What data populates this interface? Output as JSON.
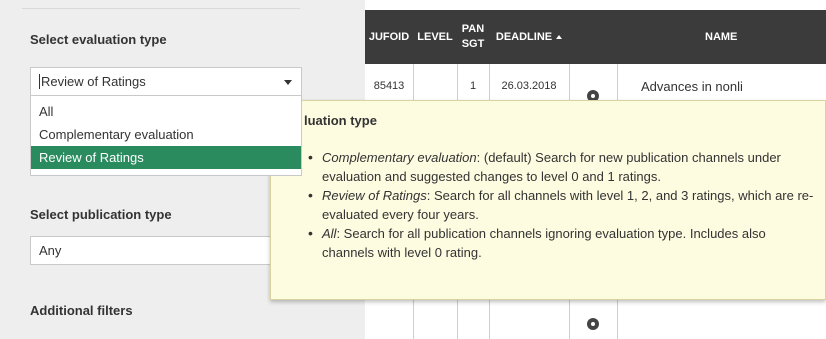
{
  "filters": {
    "evaluation_type": {
      "label": "Select evaluation type",
      "value": "Review of Ratings",
      "options": [
        "All",
        "Complementary evaluation",
        "Review of Ratings"
      ],
      "selected_index": 2
    },
    "publication_type": {
      "label": "Select publication type",
      "value": "Any"
    },
    "additional_filters_label": "Additional filters"
  },
  "table": {
    "columns": [
      {
        "key": "jufoid",
        "label": "JUFOID"
      },
      {
        "key": "level",
        "label": "LEVEL"
      },
      {
        "key": "pansgt",
        "label": "PAN SGT"
      },
      {
        "key": "deadline",
        "label": "DEADLINE"
      },
      {
        "key": "action",
        "label": ""
      },
      {
        "key": "name",
        "label": "NAME"
      }
    ],
    "sorted_column": "deadline",
    "rows": [
      {
        "jufoid": "85413",
        "level": "",
        "pansgt": "1",
        "deadline": "26.03.2018",
        "name": "Advances in nonli"
      }
    ]
  },
  "tooltip": {
    "title": "luation type",
    "items": [
      {
        "term": "Complementary evaluation",
        "text": ": (default) Search for new publication channels under evaluation and suggested changes to level 0 and 1 ratings."
      },
      {
        "term": "Review of Ratings",
        "text": ": Search for all channels with level 1, 2, and 3 ratings, which are re-evaluated every four years."
      },
      {
        "term": "All",
        "text": ": Search for all publication channels ignoring evaluation type. Includes also channels with level 0 rating."
      }
    ]
  },
  "colors": {
    "selected_option": "#2a8c5e",
    "table_header": "#3b3b3b",
    "tooltip_background": "#fdfbe0"
  },
  "icons": {
    "row_action": "gear-icon",
    "sort": "sort-ascending-icon",
    "select_caret": "chevron-down-icon"
  }
}
